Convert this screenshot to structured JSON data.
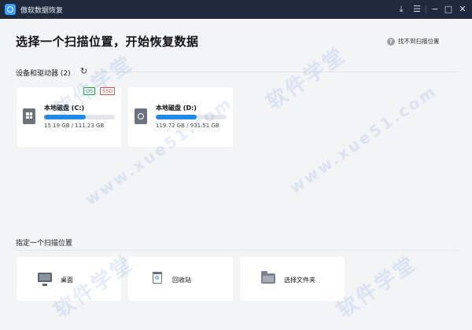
{
  "titlebar": {
    "app_title": "傲软数据恢复",
    "buttons": [
      "download-icon",
      "menu-icon",
      "minimize-icon",
      "maximize-icon",
      "close-icon"
    ]
  },
  "header": {
    "title": "选择一个扫描位置，开始恢复数据",
    "help_link": "找不到扫描位置"
  },
  "devices": {
    "label": "设备和驱动器 (2)",
    "drives": [
      {
        "name": "本地磁盘 (C:)",
        "used": "15.19 GB",
        "total": "111.23 GB",
        "size_text": "15.19 GB / 111.23 GB",
        "badges": [
          "OS",
          "SSD"
        ],
        "icon": "windows-drive-icon"
      },
      {
        "name": "本地磁盘 (D:)",
        "used": "119.72 GB",
        "total": "931.51 GB",
        "size_text": "119.72 GB / 931.51 GB",
        "badges": [],
        "icon": "hard-drive-icon"
      }
    ]
  },
  "locations": {
    "label": "指定一个扫描位置",
    "items": [
      {
        "label": "桌面",
        "icon": "monitor-icon"
      },
      {
        "label": "回收站",
        "icon": "recycle-bin-icon"
      },
      {
        "label": "选择文件夹",
        "icon": "folder-icon"
      }
    ]
  },
  "watermark": {
    "text": "软件学堂",
    "url": "www.xue51.com"
  },
  "colors": {
    "titlebar": "#1f2b3d",
    "accent": "#1f8ae6",
    "background": "#f3f4f6",
    "badge_os": "#2e9b3a",
    "badge_ssd": "#e2503c"
  }
}
